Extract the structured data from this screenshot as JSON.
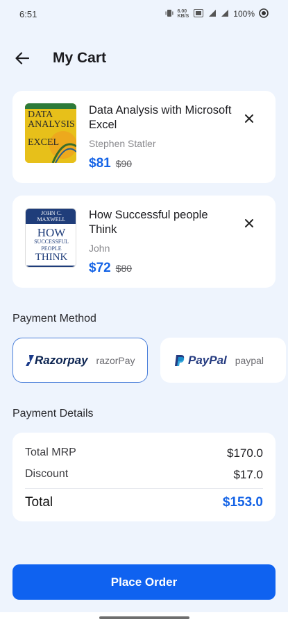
{
  "status_bar": {
    "time": "6:51",
    "speed_value": "6.00",
    "speed_unit": "KB/S",
    "battery": "100%"
  },
  "app_bar": {
    "title": "My Cart",
    "back_icon": "arrow-left-icon"
  },
  "cart_items": [
    {
      "title": "Data Analysis with Microsoft Excel",
      "author": "Stephen Statler",
      "price": "$81",
      "old_price": "$90",
      "cover_text": [
        "DATA",
        "ANALYSIS",
        "EXCEL"
      ],
      "cover_color": "#e8c21a"
    },
    {
      "title": "How Successful people Think",
      "author": "John",
      "price": "$72",
      "old_price": "$80",
      "cover_text": [
        "JOHN C.",
        "MAXWELL",
        "HOW",
        "SUCCESSFUL",
        "PEOPLE",
        "THINK"
      ],
      "cover_color": "#1f3d7a"
    }
  ],
  "payment_method": {
    "title": "Payment Method",
    "options": [
      {
        "logo": "Razorpay",
        "name": "razorPay",
        "selected": true
      },
      {
        "logo": "PayPal",
        "name": "paypal",
        "selected": false
      }
    ]
  },
  "payment_details": {
    "title": "Payment Details",
    "total_mrp_label": "Total MRP",
    "total_mrp_value": "$170.0",
    "discount_label": "Discount",
    "discount_value": "$17.0",
    "total_label": "Total",
    "total_value": "$153.0"
  },
  "actions": {
    "place_order": "Place Order"
  },
  "colors": {
    "accent": "#1463e6",
    "button": "#0f62f0",
    "background": "#eef4fd"
  }
}
